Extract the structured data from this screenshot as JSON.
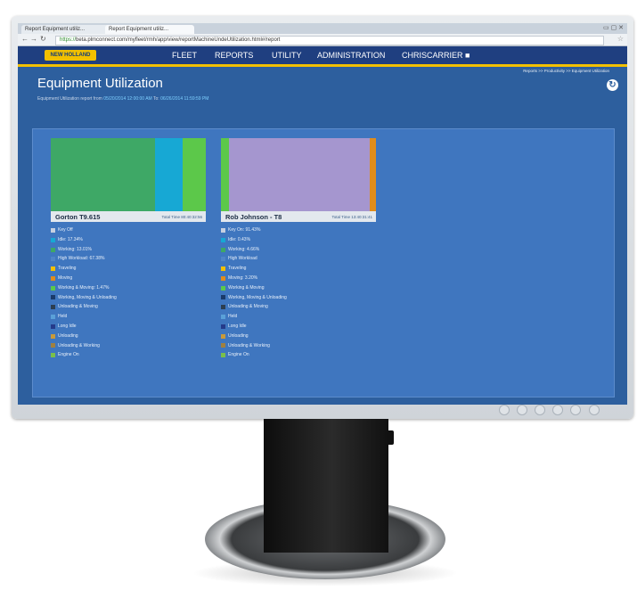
{
  "browser": {
    "tabs": [
      {
        "label": "Report Equipment utiliz..."
      },
      {
        "label": "Report Equipment utiliz..."
      }
    ],
    "url_secure": "https://",
    "url_rest": "beta.plmconnect.com/myfleet/rmh/app/view/reportMachineUndeUtilization.html#/report",
    "window_buttons": "▭ ▢ ✕"
  },
  "topnav": {
    "logo": "NEW HOLLAND",
    "items": [
      "FLEET",
      "REPORTS",
      "UTILITY",
      "ADMINISTRATION",
      "CHRISCARRIER"
    ]
  },
  "header": {
    "breadcrumb": "Reports >> Productivity >> Equipment Utilization",
    "title": "Equipment Utilization",
    "subline_label": "Equipment Utilization report from",
    "date_from": "05/20/2014 12:00:00 AM",
    "to_label": "To:",
    "date_to": "06/26/2014 11:59:59 PM"
  },
  "cards": [
    {
      "machine": "Gorton T9.615",
      "total_time": "Total Time 80:40:32:56",
      "treemap": [
        {
          "label": "Working",
          "fraction": 0.67,
          "color": "#3ea866"
        },
        {
          "label": "Idle",
          "fraction": 0.18,
          "color": "#17a8d4"
        },
        {
          "label": "Working",
          "fraction": 0.15,
          "color": "#5cc84a"
        }
      ],
      "legend": [
        {
          "text": "Key Off",
          "color": "#c6d0e0"
        },
        {
          "text": "Idle: 17.34%",
          "color": "#17a8d4"
        },
        {
          "text": "Working: 13.01%",
          "color": "#3ea866"
        },
        {
          "text": "High Workload: 67.38%",
          "color": "#4f84c8"
        },
        {
          "text": "Traveling",
          "color": "#f2c000"
        },
        {
          "text": "Moving",
          "color": "#e08d1c"
        },
        {
          "text": "Working & Moving: 1.47%",
          "color": "#5cc84a"
        },
        {
          "text": "Working, Moving & Unloading",
          "color": "#1a3a6a"
        },
        {
          "text": "Unloading & Moving",
          "color": "#2c3e50"
        },
        {
          "text": "Held",
          "color": "#5aa0d8"
        },
        {
          "text": "Long Idle",
          "color": "#243a8a"
        },
        {
          "text": "Unloading",
          "color": "#c89a3a"
        },
        {
          "text": "Unloading & Working",
          "color": "#a08040"
        },
        {
          "text": "Engine On",
          "color": "#7abf4a"
        }
      ]
    },
    {
      "machine": "Rob Johnson - T8",
      "total_time": "Total Time 13:40:31:41",
      "treemap": [
        {
          "label": "Working",
          "fraction": 0.05,
          "color": "#5cc84a"
        },
        {
          "label": "Key On",
          "fraction": 0.91,
          "color": "#a596cf"
        },
        {
          "label": "Moving",
          "fraction": 0.04,
          "color": "#e08d1c"
        }
      ],
      "legend": [
        {
          "text": "Key On: 91.43%",
          "color": "#c6d0e0"
        },
        {
          "text": "Idle: 0.43%",
          "color": "#17a8d4"
        },
        {
          "text": "Working: 4.66%",
          "color": "#3ea866"
        },
        {
          "text": "High Workload",
          "color": "#4f84c8"
        },
        {
          "text": "Traveling",
          "color": "#f2c000"
        },
        {
          "text": "Moving: 3.20%",
          "color": "#e08d1c"
        },
        {
          "text": "Working & Moving",
          "color": "#5cc84a"
        },
        {
          "text": "Working, Moving & Unloading",
          "color": "#1a3a6a"
        },
        {
          "text": "Unloading & Moving",
          "color": "#2c3e50"
        },
        {
          "text": "Held",
          "color": "#5aa0d8"
        },
        {
          "text": "Long Idle",
          "color": "#243a8a"
        },
        {
          "text": "Unloading",
          "color": "#c89a3a"
        },
        {
          "text": "Unloading & Working",
          "color": "#a08040"
        },
        {
          "text": "Engine On",
          "color": "#7abf4a"
        }
      ]
    }
  ]
}
